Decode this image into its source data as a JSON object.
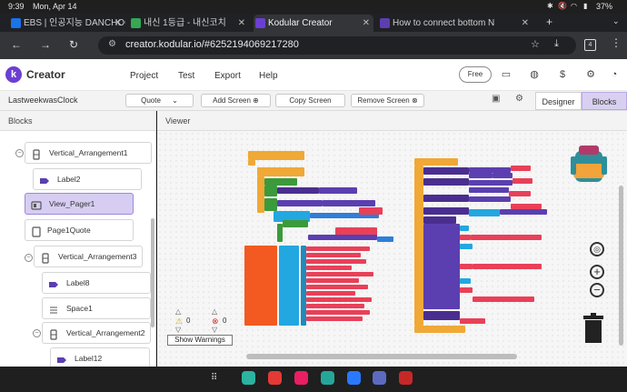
{
  "status": {
    "time": "9:39",
    "date": "Mon, Apr 14",
    "battery": "37%"
  },
  "tabs": [
    {
      "label": "EBS | 인공지능 DANCHOO",
      "icon": "ebs-icon",
      "color": "#1a73e8"
    },
    {
      "label": "내신 1등급 - 내신코치",
      "icon": "naesin-icon",
      "color": "#34a853"
    },
    {
      "label": "Kodular Creator",
      "icon": "kodular-icon",
      "color": "#6b3fd4"
    },
    {
      "label": "How to connect bottom N",
      "icon": "community-icon",
      "color": "#5b3fb0"
    }
  ],
  "address": {
    "url": "creator.kodular.io/#6252194069217280"
  },
  "header": {
    "brand": "Creator",
    "menu": [
      "Project",
      "Test",
      "Export",
      "Help"
    ],
    "plan": "Free",
    "accent": "#6b3fd4"
  },
  "toolbar": {
    "project_name": "LastweekwasClock",
    "screen": "Quote",
    "add_screen": "Add Screen",
    "copy_screen": "Copy Screen",
    "remove_screen": "Remove Screen",
    "designer": "Designer",
    "blocks": "Blocks"
  },
  "panels": {
    "blocks_title": "Blocks",
    "viewer_title": "Viewer"
  },
  "tree": [
    {
      "label": "Vertical_Arrangement1",
      "icon": "vertical-arrangement-icon",
      "collapse": true
    },
    {
      "label": "Label2",
      "icon": "label-icon"
    },
    {
      "label": "View_Pager1",
      "icon": "view-pager-icon",
      "selected": true
    },
    {
      "label": "Page1Quote",
      "icon": "page-icon",
      "collapse": true
    },
    {
      "label": "Vertical_Arrangement3",
      "icon": "vertical-arrangement-icon",
      "collapse": true
    },
    {
      "label": "Label8",
      "icon": "label-icon"
    },
    {
      "label": "Space1",
      "icon": "space-icon"
    },
    {
      "label": "Vertical_Arrangement2",
      "icon": "vertical-arrangement-icon",
      "collapse": true
    },
    {
      "label": "Label12",
      "icon": "label-icon"
    }
  ],
  "warnings": {
    "warning_count": "0",
    "error_count": "0",
    "toggle_label": "Show Warnings"
  },
  "dock_apps": [
    "calendar-icon",
    "flipboard-icon",
    "gallery-icon",
    "calendar2-icon",
    "messages-icon",
    "internet-icon",
    "camera-icon"
  ]
}
